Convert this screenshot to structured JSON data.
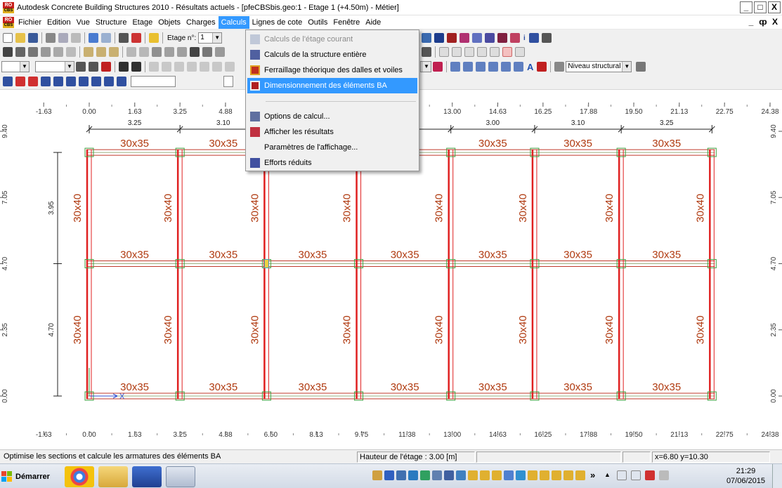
{
  "window": {
    "title": "Autodesk Concrete Building Structures 2010 - Résultats actuels - [pfeCBSbis.geo:1 - Etage 1 (+4.50m) - Métier]",
    "logo_top": "RO",
    "logo_bottom": "CBS",
    "min": "_",
    "max": "□",
    "close": "X"
  },
  "menubar": {
    "items": [
      "Fichier",
      "Edition",
      "Vue",
      "Structure",
      "Etage",
      "Objets",
      "Charges",
      "Calculs",
      "Lignes de cote",
      "Outils",
      "Fenêtre",
      "Aide"
    ],
    "active_index": 7,
    "mdi_min": "_",
    "mdi_restore": "ȹ",
    "mdi_close": "X"
  },
  "toolbar": {
    "etage_label": "Etage n°:",
    "etage_value": "1",
    "niveau_value": "Niveau structural",
    "text_tool": "A",
    "info_tool": "i"
  },
  "dropdown": {
    "items": [
      {
        "label": "Calculs de l'étage courant",
        "disabled": true
      },
      {
        "label": "Calculs de la structure entière",
        "disabled": false
      },
      {
        "label": "Ferraillage théorique des dalles et voiles",
        "disabled": false
      },
      {
        "label": "Dimensionnement des éléments BA",
        "disabled": false,
        "highlighted": true
      },
      {
        "label": "Options de calcul...",
        "disabled": false
      },
      {
        "label": "Afficher les résultats",
        "disabled": false
      },
      {
        "label": "Paramètres de l'affichage...",
        "disabled": false
      },
      {
        "label": "Efforts réduits",
        "disabled": false
      }
    ]
  },
  "drawing": {
    "ruler_x": [
      {
        "v": -1.63,
        "t": "-1.63"
      },
      {
        "v": 0.0,
        "t": "0.00"
      },
      {
        "v": 1.63,
        "t": "1.63"
      },
      {
        "v": 3.25,
        "t": "3.25"
      },
      {
        "v": 4.88,
        "t": "4.88"
      },
      {
        "v": 6.5,
        "t": "6.50"
      },
      {
        "v": 8.13,
        "t": "8.13"
      },
      {
        "v": 9.75,
        "t": "9.75"
      },
      {
        "v": 11.38,
        "t": "11.38"
      },
      {
        "v": 13.0,
        "t": "13.00"
      },
      {
        "v": 14.63,
        "t": "14.63"
      },
      {
        "v": 16.25,
        "t": "16.25"
      },
      {
        "v": 17.88,
        "t": "17.88"
      },
      {
        "v": 19.5,
        "t": "19.50"
      },
      {
        "v": 21.13,
        "t": "21.13"
      },
      {
        "v": 22.75,
        "t": "22.75"
      },
      {
        "v": 24.38,
        "t": "24.38"
      }
    ],
    "ruler_y": [
      {
        "v": 9.4,
        "t": "9.40"
      },
      {
        "v": 7.05,
        "t": "7.05"
      },
      {
        "v": 4.7,
        "t": "4.70"
      },
      {
        "v": 2.35,
        "t": "2.35"
      },
      {
        "v": 0.0,
        "t": "0.00"
      }
    ],
    "grid_x": [
      0.0,
      3.25,
      6.35,
      9.65,
      12.95,
      15.95,
      19.05,
      22.3
    ],
    "grid_y": [
      0.0,
      4.7,
      8.65
    ],
    "span_dims": [
      "3.25",
      "3.10",
      "3.00",
      "3.10",
      "3.25"
    ],
    "vertical_dims": [
      "3.95",
      "4.70"
    ],
    "beam_label": "30x35",
    "column_label": "30x40",
    "axis_label": "X"
  },
  "statusbar": {
    "message": "Optimise les sections et calcule les armatures des éléments BA",
    "floor_height": "Hauteur de l'étage : 3.00 [m]",
    "coords": "x=6.80  y=10.30"
  },
  "taskbar": {
    "start_label": "Démarrer",
    "time": "21:29",
    "date": "07/06/2015",
    "chevron": "»",
    "up_arrow": "▲"
  }
}
